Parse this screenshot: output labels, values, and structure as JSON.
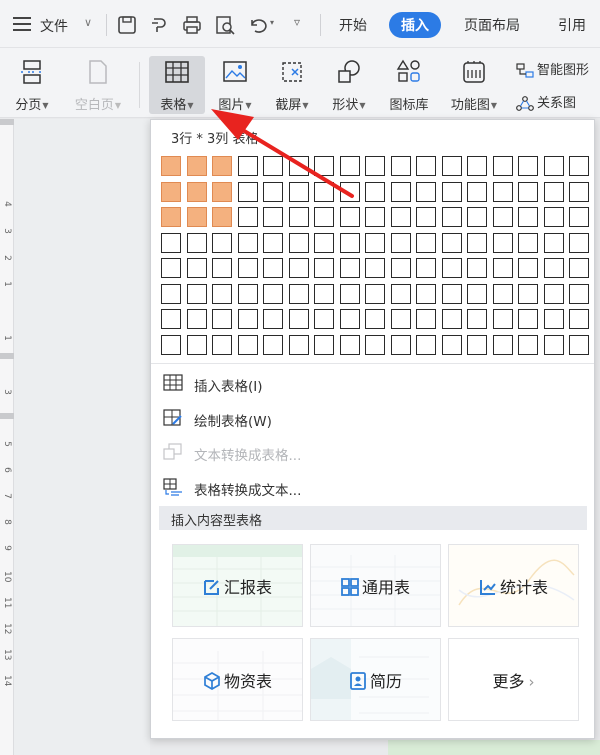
{
  "menubar": {
    "file_label": "文件",
    "tabs": [
      {
        "label": "开始",
        "active": false
      },
      {
        "label": "插入",
        "active": true
      },
      {
        "label": "页面布局",
        "active": false
      },
      {
        "label": "引用",
        "active": false
      }
    ]
  },
  "ribbon": {
    "buttons": [
      {
        "label": "分页",
        "icon": "page-break-icon",
        "disabled": false
      },
      {
        "label": "空白页",
        "icon": "blank-page-icon",
        "disabled": true
      },
      {
        "label": "表格",
        "icon": "table-icon",
        "disabled": false,
        "selected": true
      },
      {
        "label": "图片",
        "icon": "picture-icon",
        "disabled": false
      },
      {
        "label": "截屏",
        "icon": "screenshot-icon",
        "disabled": false
      },
      {
        "label": "形状",
        "icon": "shapes-icon",
        "disabled": false
      },
      {
        "label": "图标库",
        "icon": "icon-library-icon",
        "disabled": false
      },
      {
        "label": "功能图",
        "icon": "function-chart-icon",
        "disabled": false
      }
    ],
    "small_buttons": [
      {
        "label": "智能图形",
        "icon": "smart-art-icon"
      },
      {
        "label": "关系图",
        "icon": "relation-chart-icon"
      }
    ]
  },
  "ruler": {
    "numbers": [
      "4",
      "3",
      "2",
      "1",
      "1",
      "3",
      "5",
      "6",
      "7",
      "8",
      "9",
      "10",
      "11",
      "12",
      "13",
      "14"
    ]
  },
  "table_menu": {
    "size_label": "3行 * 3列 表格",
    "grid": {
      "rows": 8,
      "cols": 17,
      "selected_rows": 3,
      "selected_cols": 3
    },
    "items": [
      {
        "label": "插入表格(I)",
        "icon": "insert-table-icon",
        "disabled": false
      },
      {
        "label": "绘制表格(W)",
        "icon": "draw-table-icon",
        "disabled": false
      },
      {
        "label": "文本转换成表格...",
        "icon": "text-to-table-icon",
        "disabled": true
      },
      {
        "label": "表格转换成文本...",
        "icon": "table-to-text-icon",
        "disabled": false
      }
    ],
    "section_title": "插入内容型表格",
    "templates": [
      {
        "label": "汇报表",
        "icon": "report-icon"
      },
      {
        "label": "通用表",
        "icon": "grid-icon"
      },
      {
        "label": "统计表",
        "icon": "chart-icon"
      },
      {
        "label": "物资表",
        "icon": "box-icon"
      },
      {
        "label": "简历",
        "icon": "resume-icon"
      },
      {
        "label": "更多",
        "icon": "chevron-right-icon"
      }
    ]
  },
  "colors": {
    "accent": "#2c7be5",
    "selected_cell": "#f4b17f",
    "arrow": "#e8231f",
    "template_icon": "#2f7fd6"
  }
}
